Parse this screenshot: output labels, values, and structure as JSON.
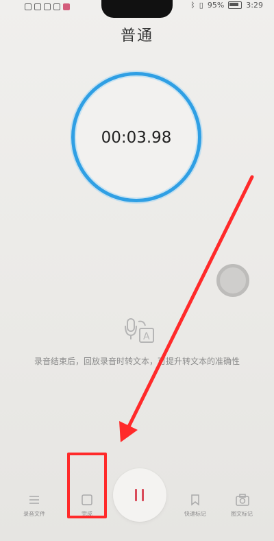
{
  "status_bar": {
    "battery_text": "95%",
    "time": "3:29"
  },
  "mode_title": "普通",
  "timer": "00:03.98",
  "hint_text": "录音结束后，回放录音时转文本，可提升转文本的准确性",
  "nav": {
    "files_label": "录音文件",
    "stop_label": "完成",
    "quick_mark_label": "快速标记",
    "photo_mark_label": "图文标记"
  },
  "colors": {
    "ring": "#2f9fe4",
    "pause": "#d94b5a",
    "annotation": "#ff2a2a"
  },
  "icons": [
    "list-icon",
    "stop-icon",
    "pause-icon",
    "bookmark-icon",
    "camera-icon",
    "mic-translate-icon"
  ]
}
